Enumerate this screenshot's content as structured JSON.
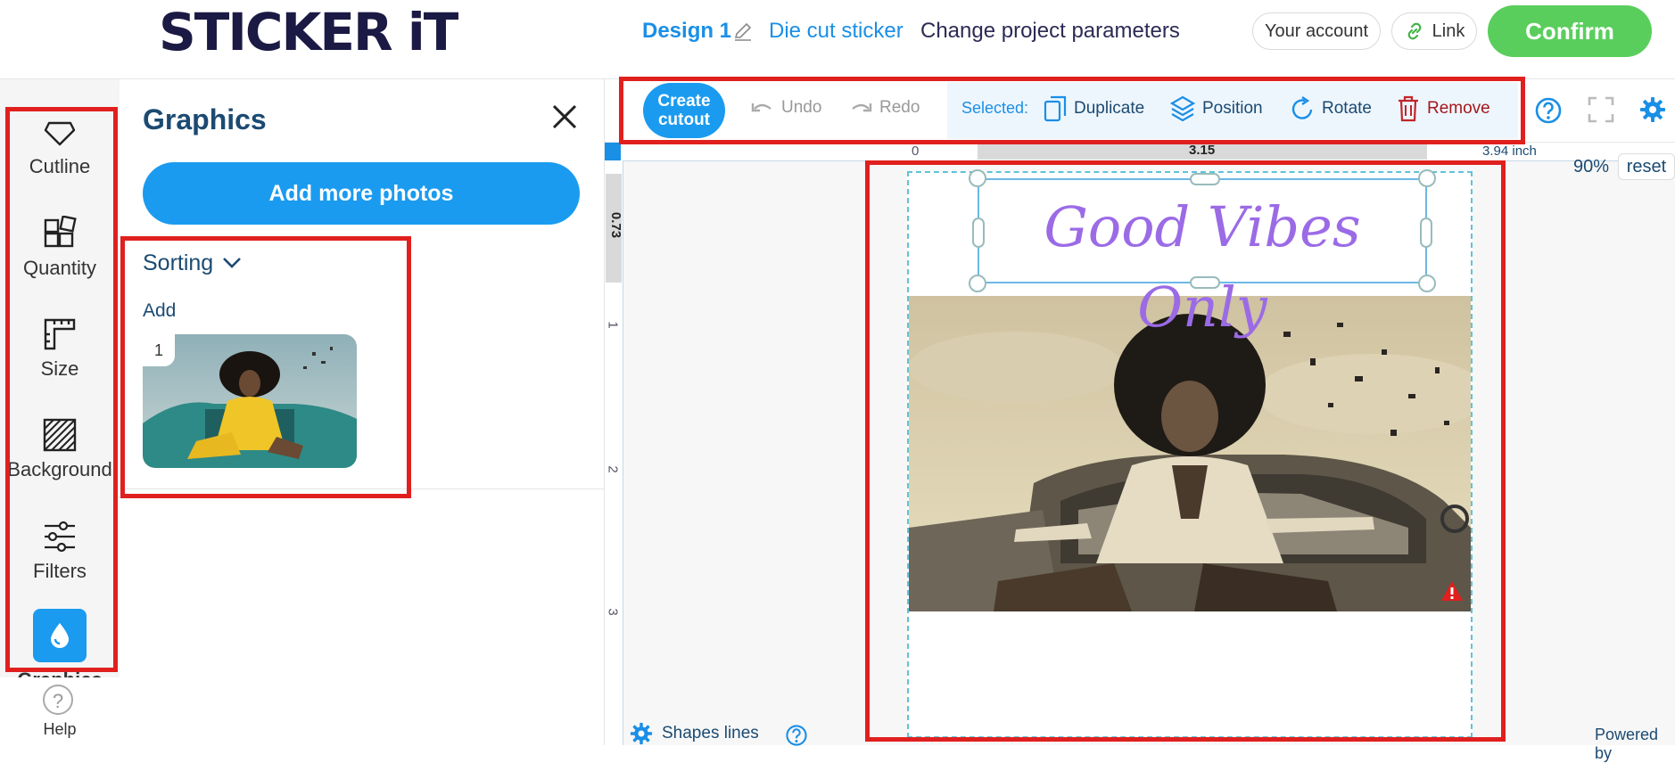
{
  "header": {
    "logo": "STICKER iT",
    "design_name": "Design 1",
    "product": "Die cut sticker",
    "change_params": "Change project parameters",
    "account": "Your account",
    "link": "Link",
    "confirm": "Confirm"
  },
  "sidebar": {
    "items": [
      {
        "label": "Cutline",
        "icon": "cutline-icon"
      },
      {
        "label": "Quantity",
        "icon": "quantity-icon"
      },
      {
        "label": "Size",
        "icon": "ruler-icon"
      },
      {
        "label": "Background",
        "icon": "background-icon"
      },
      {
        "label": "Filters",
        "icon": "filters-icon"
      }
    ],
    "active": "Graphics",
    "help": "Help"
  },
  "panel": {
    "title": "Graphics",
    "add_photos": "Add more photos",
    "sorting": "Sorting",
    "add": "Add",
    "thumb_index": "1"
  },
  "toolbar": {
    "create_cutout": "Create cutout",
    "undo": "Undo",
    "redo": "Redo",
    "selected": "Selected:",
    "duplicate": "Duplicate",
    "position": "Position",
    "rotate": "Rotate",
    "remove": "Remove"
  },
  "workspace": {
    "ruler_top_zero": "0",
    "ruler_top_value": "3.15",
    "ruler_top_total": "3.94 inch",
    "ruler_left_value": "0.73",
    "ruler_left_1": "1",
    "ruler_left_2": "2",
    "ruler_left_3": "3",
    "zoom": "90%",
    "reset": "reset",
    "text": "Good Vibes Only",
    "shapes_lines": "Shapes lines",
    "powered": "Powered by"
  },
  "colors": {
    "accent": "#1a9bf0",
    "confirm": "#5ace5c",
    "remove": "#a3181c",
    "text_art": "#9b6be6",
    "annotation": "#e0201e"
  }
}
